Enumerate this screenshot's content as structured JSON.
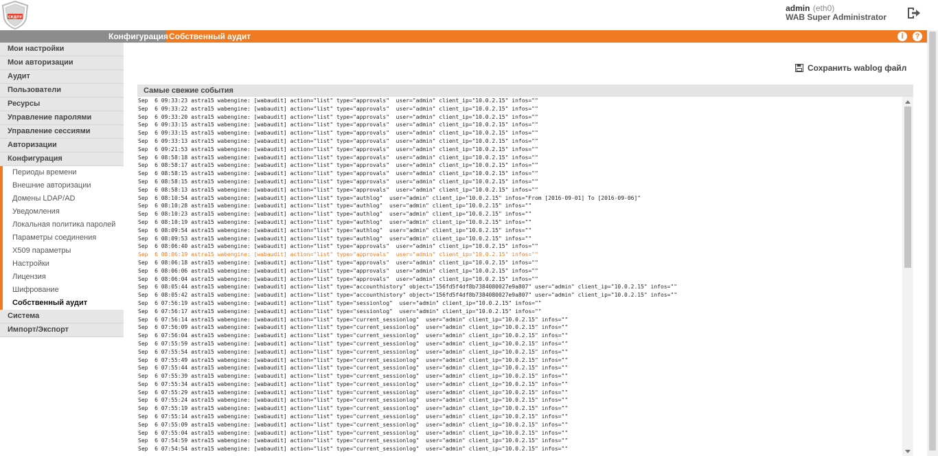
{
  "header": {
    "logo_text": "СКДПУ",
    "user": "admin",
    "interface": "(eth0)",
    "role": "WAB Super Administrator"
  },
  "navbar": {
    "section": "Конфигурация",
    "page": "Собственный аудит",
    "info_icon": "info-icon",
    "help_icon": "help-icon"
  },
  "sidebar": {
    "items_top": [
      "Мои настройки",
      "Мои авторизации",
      "Аудит",
      "Пользователи",
      "Ресурсы",
      "Управление паролями",
      "Управление сессиями",
      "Авторизации",
      "Конфигурация"
    ],
    "subitems": [
      "Периоды времени",
      "Внешние авторизации",
      "Домены LDAP/AD",
      "Уведомления",
      "Локальная политика паролей",
      "Параметры соединения",
      "X509 параметры",
      "Настройки",
      "Лицензия",
      "Шифрование",
      "Собственный аудит"
    ],
    "items_bottom": [
      "Система",
      "Импорт/Экспорт"
    ]
  },
  "main": {
    "save_label": "Сохранить wablog файл",
    "events_title": "Самые свежие события",
    "highlight_index": 19,
    "log_lines": [
      "Sep  6 09:33:23 astra15 wabengine: [wabaudit] action=\"list\" type=\"approvals\"  user=\"admin\" client_ip=\"10.0.2.15\" infos=\"\"",
      "Sep  6 09:33:22 astra15 wabengine: [wabaudit] action=\"list\" type=\"approvals\"  user=\"admin\" client_ip=\"10.0.2.15\" infos=\"\"",
      "Sep  6 09:33:20 astra15 wabengine: [wabaudit] action=\"list\" type=\"approvals\"  user=\"admin\" client_ip=\"10.0.2.15\" infos=\"\"",
      "Sep  6 09:33:15 astra15 wabengine: [wabaudit] action=\"list\" type=\"approvals\"  user=\"admin\" client_ip=\"10.0.2.15\" infos=\"\"",
      "Sep  6 09:33:15 astra15 wabengine: [wabaudit] action=\"list\" type=\"approvals\"  user=\"admin\" client_ip=\"10.0.2.15\" infos=\"\"",
      "Sep  6 09:33:13 astra15 wabengine: [wabaudit] action=\"list\" type=\"approvals\"  user=\"admin\" client_ip=\"10.0.2.15\" infos=\"\"",
      "Sep  6 09:21:53 astra15 wabengine: [wabaudit] action=\"list\" type=\"approvals\"  user=\"admin\" client_ip=\"10.0.2.15\" infos=\"\"",
      "Sep  6 08:58:18 astra15 wabengine: [wabaudit] action=\"list\" type=\"approvals\"  user=\"admin\" client_ip=\"10.0.2.15\" infos=\"\"",
      "Sep  6 08:58:17 astra15 wabengine: [wabaudit] action=\"list\" type=\"approvals\"  user=\"admin\" client_ip=\"10.0.2.15\" infos=\"\"",
      "Sep  6 08:58:15 astra15 wabengine: [wabaudit] action=\"list\" type=\"approvals\"  user=\"admin\" client_ip=\"10.0.2.15\" infos=\"\"",
      "Sep  6 08:58:15 astra15 wabengine: [wabaudit] action=\"list\" type=\"approvals\"  user=\"admin\" client_ip=\"10.0.2.15\" infos=\"\"",
      "Sep  6 08:58:13 astra15 wabengine: [wabaudit] action=\"list\" type=\"approvals\"  user=\"admin\" client_ip=\"10.0.2.15\" infos=\"\"",
      "Sep  6 08:10:54 astra15 wabengine: [wabaudit] action=\"list\" type=\"authlog\"  user=\"admin\" client_ip=\"10.0.2.15\" infos=\"From [2016-09-01] To [2016-09-06]\"",
      "Sep  6 08:10:28 astra15 wabengine: [wabaudit] action=\"list\" type=\"authlog\"  user=\"admin\" client_ip=\"10.0.2.15\" infos=\"\"",
      "Sep  6 08:10:23 astra15 wabengine: [wabaudit] action=\"list\" type=\"authlog\"  user=\"admin\" client_ip=\"10.0.2.15\" infos=\"\"",
      "Sep  6 08:10:19 astra15 wabengine: [wabaudit] action=\"list\" type=\"authlog\"  user=\"admin\" client_ip=\"10.0.2.15\" infos=\"\"",
      "Sep  6 08:09:54 astra15 wabengine: [wabaudit] action=\"list\" type=\"authlog\"  user=\"admin\" client_ip=\"10.0.2.15\" infos=\"\"",
      "Sep  6 08:09:53 astra15 wabengine: [wabaudit] action=\"list\" type=\"authlog\"  user=\"admin\" client_ip=\"10.0.2.15\" infos=\"\"",
      "Sep  6 08:06:40 astra15 wabengine: [wabaudit] action=\"list\" type=\"approvals\"  user=\"admin\" client_ip=\"10.0.2.15\" infos=\"\"",
      "Sep  6 08:06:19 astra15 wabengine: [wabaudit] action=\"list\" type=\"approvals\"  user=\"admin\" client_ip=\"10.0.2.15\" infos=\"\"",
      "Sep  6 08:06:18 astra15 wabengine: [wabaudit] action=\"list\" type=\"approvals\"  user=\"admin\" client_ip=\"10.0.2.15\" infos=\"\"",
      "Sep  6 08:06:06 astra15 wabengine: [wabaudit] action=\"list\" type=\"approvals\"  user=\"admin\" client_ip=\"10.0.2.15\" infos=\"\"",
      "Sep  6 08:06:04 astra15 wabengine: [wabaudit] action=\"list\" type=\"approvals\"  user=\"admin\" client_ip=\"10.0.2.15\" infos=\"\"",
      "Sep  6 08:05:44 astra15 wabengine: [wabaudit] action=\"list\" type=\"accounthistory\" object=\"156fd5f4df8b7384080027e9a807\" user=\"admin\" client_ip=\"10.0.2.15\" infos=\"\"",
      "Sep  6 08:05:42 astra15 wabengine: [wabaudit] action=\"list\" type=\"accounthistory\" object=\"156fd5f4df8b7384080027e9a807\" user=\"admin\" client_ip=\"10.0.2.15\" infos=\"\"",
      "Sep  6 07:56:19 astra15 wabengine: [wabaudit] action=\"list\" type=\"sessionlog\"  user=\"admin\" client_ip=\"10.0.2.15\" infos=\"\"",
      "Sep  6 07:56:17 astra15 wabengine: [wabaudit] action=\"list\" type=\"sessionlog\"  user=\"admin\" client_ip=\"10.0.2.15\" infos=\"\"",
      "Sep  6 07:56:14 astra15 wabengine: [wabaudit] action=\"list\" type=\"current_sessionlog\"  user=\"admin\" client_ip=\"10.0.2.15\" infos=\"\"",
      "Sep  6 07:56:09 astra15 wabengine: [wabaudit] action=\"list\" type=\"current_sessionlog\"  user=\"admin\" client_ip=\"10.0.2.15\" infos=\"\"",
      "Sep  6 07:56:04 astra15 wabengine: [wabaudit] action=\"list\" type=\"current_sessionlog\"  user=\"admin\" client_ip=\"10.0.2.15\" infos=\"\"",
      "Sep  6 07:55:59 astra15 wabengine: [wabaudit] action=\"list\" type=\"current_sessionlog\"  user=\"admin\" client_ip=\"10.0.2.15\" infos=\"\"",
      "Sep  6 07:55:54 astra15 wabengine: [wabaudit] action=\"list\" type=\"current_sessionlog\"  user=\"admin\" client_ip=\"10.0.2.15\" infos=\"\"",
      "Sep  6 07:55:49 astra15 wabengine: [wabaudit] action=\"list\" type=\"current_sessionlog\"  user=\"admin\" client_ip=\"10.0.2.15\" infos=\"\"",
      "Sep  6 07:55:44 astra15 wabengine: [wabaudit] action=\"list\" type=\"current_sessionlog\"  user=\"admin\" client_ip=\"10.0.2.15\" infos=\"\"",
      "Sep  6 07:55:39 astra15 wabengine: [wabaudit] action=\"list\" type=\"current_sessionlog\"  user=\"admin\" client_ip=\"10.0.2.15\" infos=\"\"",
      "Sep  6 07:55:34 astra15 wabengine: [wabaudit] action=\"list\" type=\"current_sessionlog\"  user=\"admin\" client_ip=\"10.0.2.15\" infos=\"\"",
      "Sep  6 07:55:29 astra15 wabengine: [wabaudit] action=\"list\" type=\"current_sessionlog\"  user=\"admin\" client_ip=\"10.0.2.15\" infos=\"\"",
      "Sep  6 07:55:24 astra15 wabengine: [wabaudit] action=\"list\" type=\"current_sessionlog\"  user=\"admin\" client_ip=\"10.0.2.15\" infos=\"\"",
      "Sep  6 07:55:19 astra15 wabengine: [wabaudit] action=\"list\" type=\"current_sessionlog\"  user=\"admin\" client_ip=\"10.0.2.15\" infos=\"\"",
      "Sep  6 07:55:14 astra15 wabengine: [wabaudit] action=\"list\" type=\"current_sessionlog\"  user=\"admin\" client_ip=\"10.0.2.15\" infos=\"\"",
      "Sep  6 07:55:09 astra15 wabengine: [wabaudit] action=\"list\" type=\"current_sessionlog\"  user=\"admin\" client_ip=\"10.0.2.15\" infos=\"\"",
      "Sep  6 07:55:04 astra15 wabengine: [wabaudit] action=\"list\" type=\"current_sessionlog\"  user=\"admin\" client_ip=\"10.0.2.15\" infos=\"\"",
      "Sep  6 07:54:59 astra15 wabengine: [wabaudit] action=\"list\" type=\"current_sessionlog\"  user=\"admin\" client_ip=\"10.0.2.15\" infos=\"\"",
      "Sep  6 07:54:54 astra15 wabengine: [wabaudit] action=\"list\" type=\"current_sessionlog\"  user=\"admin\" client_ip=\"10.0.2.15\" infos=\"\""
    ]
  },
  "colors": {
    "accent": "#f07a22",
    "nav_grey": "#8c8c8c"
  }
}
